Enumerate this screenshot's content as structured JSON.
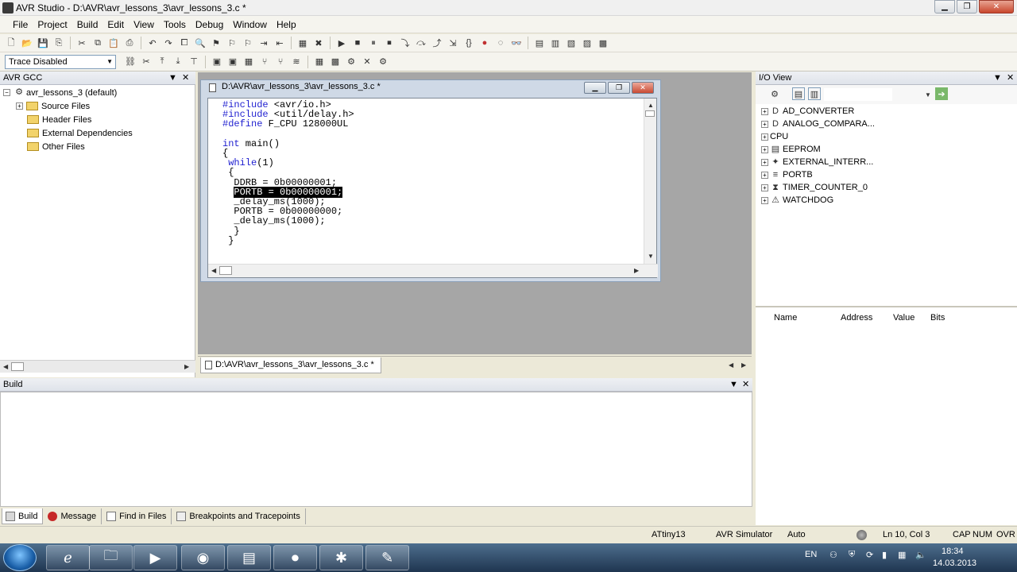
{
  "window": {
    "title": "AVR Studio - D:\\AVR\\avr_lessons_3\\avr_lessons_3.c *"
  },
  "menu": [
    "File",
    "Project",
    "Build",
    "Edit",
    "View",
    "Tools",
    "Debug",
    "Window",
    "Help"
  ],
  "toolbar2": {
    "trace_value": "Trace Disabled"
  },
  "project_panel": {
    "title": "AVR GCC",
    "root": "avr_lessons_3 (default)",
    "folders": [
      "Source Files",
      "Header Files",
      "External Dependencies",
      "Other Files"
    ]
  },
  "editor": {
    "window_title": "D:\\AVR\\avr_lessons_3\\avr_lessons_3.c *",
    "code_lines": [
      {
        "pre": "",
        "kw": "#include",
        "post": " <avr/io.h>"
      },
      {
        "pre": "",
        "kw": "#include",
        "post": " <util/delay.h>"
      },
      {
        "pre": "",
        "kw": "#define",
        "post": " F_CPU 128000UL"
      },
      {
        "pre": "",
        "kw": "",
        "post": ""
      },
      {
        "pre": "",
        "kw": "int",
        "post": " main()"
      },
      {
        "pre": "{",
        "kw": "",
        "post": ""
      },
      {
        "pre": " ",
        "kw": "while",
        "post": "(1)"
      },
      {
        "pre": " {",
        "kw": "",
        "post": ""
      },
      {
        "pre": "  DDRB = 0b00000001;",
        "kw": "",
        "post": ""
      },
      {
        "pre": "  ",
        "sel": "PORTB = 0b00000001;",
        "kw": "",
        "post": ""
      },
      {
        "pre": "  _delay_ms(1000);",
        "kw": "",
        "post": ""
      },
      {
        "pre": "  PORTB = 0b00000000;",
        "kw": "",
        "post": ""
      },
      {
        "pre": "  _delay_ms(1000);",
        "kw": "",
        "post": ""
      },
      {
        "pre": "  }",
        "kw": "",
        "post": ""
      },
      {
        "pre": " }",
        "kw": "",
        "post": ""
      }
    ],
    "tab_label": "D:\\AVR\\avr_lessons_3\\avr_lessons_3.c *"
  },
  "io_view": {
    "title": "I/O View",
    "items": [
      {
        "label": "AD_CONVERTER",
        "icon": "adc-icon"
      },
      {
        "label": "ANALOG_COMPARA...",
        "icon": "comparator-icon"
      },
      {
        "label": "CPU",
        "icon": "cpu-icon"
      },
      {
        "label": "EEPROM",
        "icon": "eeprom-icon"
      },
      {
        "label": "EXTERNAL_INTERR...",
        "icon": "interrupt-icon"
      },
      {
        "label": "PORTB",
        "icon": "port-icon"
      },
      {
        "label": "TIMER_COUNTER_0",
        "icon": "timer-icon"
      },
      {
        "label": "WATCHDOG",
        "icon": "watchdog-icon"
      }
    ],
    "columns": [
      "Name",
      "Address",
      "Value",
      "Bits"
    ]
  },
  "build_panel": {
    "title": "Build",
    "tabs": [
      "Build",
      "Message",
      "Find in Files",
      "Breakpoints and Tracepoints"
    ]
  },
  "status": {
    "device": "ATtiny13",
    "platform": "AVR Simulator",
    "mode": "Auto",
    "position": "Ln 10, Col 3",
    "caps": "CAP",
    "num": "NUM",
    "ovr": "OVR"
  },
  "tray": {
    "lang": "EN",
    "time": "18:34",
    "date": "14.03.2013"
  },
  "colors": {
    "keyword": "#1f1fd0",
    "selection": "#000000",
    "mdi_background": "#a6a6a6"
  }
}
